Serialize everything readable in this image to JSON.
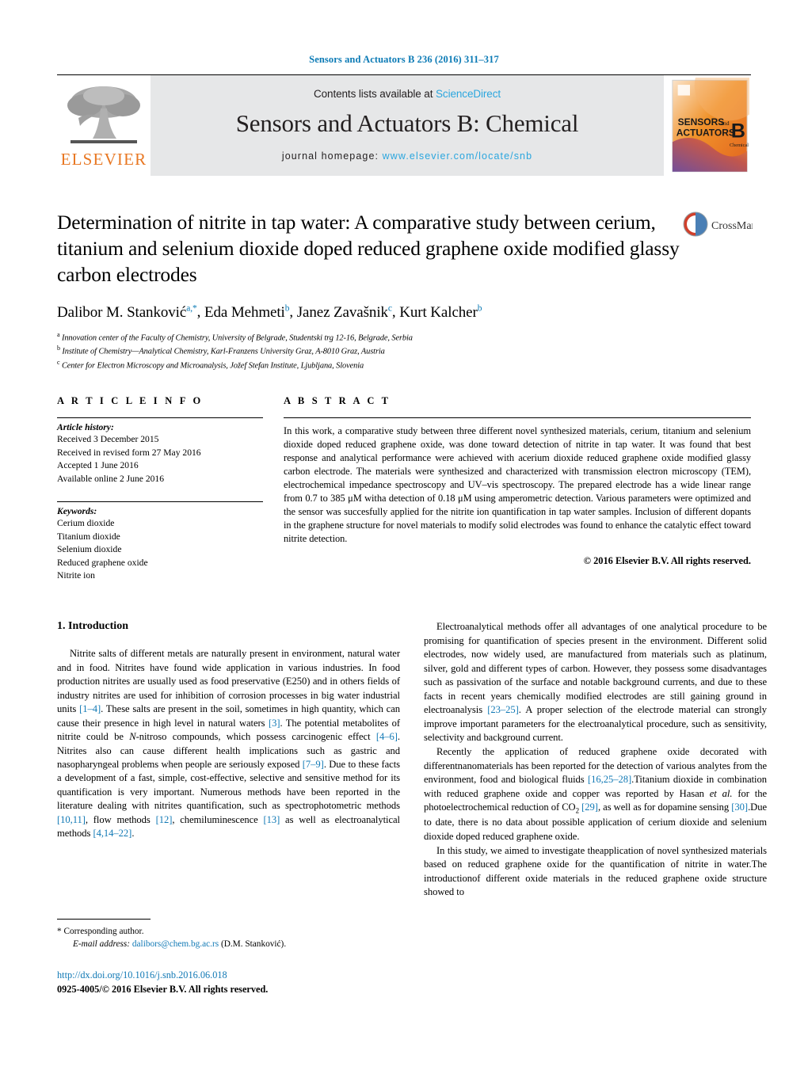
{
  "running_head": "Sensors and Actuators B 236 (2016) 311–317",
  "masthead": {
    "publisher_name": "ELSEVIER",
    "contents_prefix": "Contents lists available at ",
    "contents_link": "ScienceDirect",
    "journal_title": "Sensors and Actuators B: Chemical",
    "homepage_prefix": "journal homepage: ",
    "homepage_url": "www.elsevier.com/locate/snb",
    "cover": {
      "line1": "SENSORS",
      "and": "and",
      "line2": "ACTUATORS",
      "letter": "B",
      "sub": "Chemical"
    }
  },
  "article": {
    "title": "Determination of nitrite in tap water: A comparative study between cerium, titanium and selenium dioxide doped reduced graphene oxide modified glassy carbon electrodes",
    "crossmark_label": "CrossMark",
    "authors": [
      {
        "name": "Dalibor M. Stanković",
        "marks": "a,*"
      },
      {
        "name": "Eda Mehmeti",
        "marks": "b"
      },
      {
        "name": "Janez Zavašnik",
        "marks": "c"
      },
      {
        "name": "Kurt Kalcher",
        "marks": "b"
      }
    ],
    "affiliations": [
      {
        "mark": "a",
        "text": "Innovation center of the Faculty of Chemistry, University of Belgrade, Studentski trg 12-16, Belgrade, Serbia"
      },
      {
        "mark": "b",
        "text": "Institute of Chemistry—Analytical Chemistry, Karl-Franzens University Graz, A-8010 Graz, Austria"
      },
      {
        "mark": "c",
        "text": "Center for Electron Microscopy and Microanalysis, Jožef Stefan Institute, Ljubljana, Slovenia"
      }
    ]
  },
  "article_info": {
    "heading": "A R T I C L E   I N F O",
    "history_heading": "Article history:",
    "history": [
      "Received 3 December 2015",
      "Received in revised form 27 May 2016",
      "Accepted 1 June 2016",
      "Available online 2 June 2016"
    ],
    "keywords_heading": "Keywords:",
    "keywords": [
      "Cerium dioxide",
      "Titanium dioxide",
      "Selenium dioxide",
      "Reduced graphene oxide",
      "Nitrite ion"
    ]
  },
  "abstract": {
    "heading": "A B S T R A C T",
    "text": "In this work, a comparative study between three different novel synthesized materials, cerium, titanium and selenium dioxide doped reduced graphene oxide, was done toward detection of nitrite in tap water. It was found that best response and analytical performance were achieved with acerium dioxide reduced graphene oxide modified glassy carbon electrode. The materials were synthesized and characterized with transmission electron microscopy (TEM), electrochemical impedance spectroscopy and UV–vis spectroscopy. The prepared electrode has a wide linear range from 0.7 to 385 μM witha detection of 0.18 μM using amperometric detection. Various parameters were optimized and the sensor was succesfully applied for the nitrite ion quantification in tap water samples. Inclusion of different dopants in the graphene structure for novel materials to modify solid electrodes was found to enhance the catalytic effect toward nitrite detection.",
    "copyright": "© 2016 Elsevier B.V. All rights reserved."
  },
  "introduction": {
    "heading": "1.  Introduction",
    "left_paragraphs": [
      "Nitrite salts of different metals are naturally present in environment, natural water and in food. Nitrites have found wide application in various industries. In food production nitrites are usually used as food preservative (E250) and in others fields of industry nitrites are used for inhibition of corrosion processes in big water industrial units [1–4]. These salts are present in the soil, sometimes in high quantity, which can cause their presence in high level in natural waters [3]. The potential metabolites of nitrite could be N-nitroso compounds, which possess carcinogenic effect [4–6]. Nitrites also can cause different health implications such as gastric and nasopharyngeal problems when people are seriously exposed [7–9]. Due to these facts a development of a fast, simple, cost-effective, selective and sensitive method for its quantification is very important. Numerous methods have been reported in the literature dealing with nitrites quantification, such as spectrophotometric methods [10,11], flow methods [12], chemiluminescence [13] as well as electroanalytical methods [4,14–22]."
    ],
    "right_paragraphs": [
      "Electroanalytical methods offer all advantages of one analytical procedure to be promising for quantification of species present in the environment. Different solid electrodes, now widely used, are manufactured from materials such as platinum, silver, gold and different types of carbon. However, they possess some disadvantages such as passivation of the surface and notable background currents, and due to these facts in recent years chemically modified electrodes are still gaining ground in electroanalysis [23–25]. A proper selection of the electrode material can strongly improve important parameters for the electroanalytical procedure, such as sensitivity, selectivity and background current.",
      "Recently the application of reduced graphene oxide decorated with differentnanomaterials has been reported for the detection of various analytes from the environment, food and biological fluids [16,25–28].Titanium dioxide in combination with reduced graphene oxide and copper was reported by Hasan et al. for the photoelectrochemical reduction of CO2 [29], as well as for dopamine sensing [30].Due to date, there is no data about possible application of cerium dioxide and selenium dioxide doped reduced graphene oxide.",
      "In this study, we aimed to investigate theapplication of novel synthesized materials based on reduced graphene oxide for the quantification of nitrite in water.The introductionof different oxide materials in the reduced graphene oxide structure showed to"
    ]
  },
  "footnote": {
    "corresponding_marker": "*",
    "corresponding_text": "Corresponding author.",
    "email_label": "E-mail address:",
    "email": "dalibors@chem.bg.ac.rs",
    "email_owner": "(D.M. Stanković)."
  },
  "footer": {
    "doi": "http://dx.doi.org/10.1016/j.snb.2016.06.018",
    "issn_line": "0925-4005/© 2016 Elsevier B.V. All rights reserved."
  },
  "colors": {
    "link": "#1179b5",
    "running_head": "#0b7ab5",
    "elsevier_orange": "#E87722",
    "masthead_bg": "#e6e7e8"
  }
}
